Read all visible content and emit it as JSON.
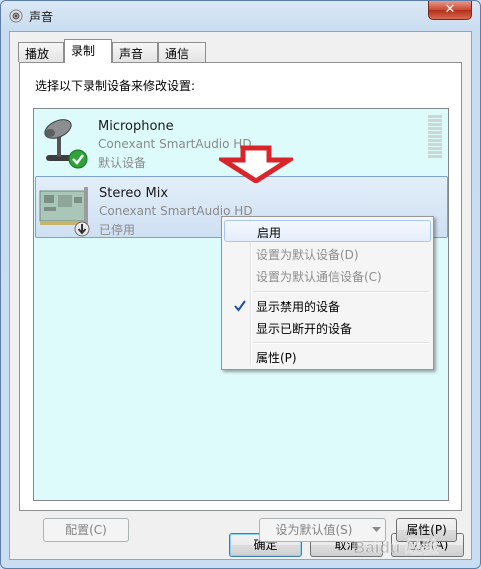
{
  "window": {
    "title": "声音",
    "close_icon": "close-icon"
  },
  "tabs": [
    {
      "label": "播放",
      "active": false
    },
    {
      "label": "录制",
      "active": true
    },
    {
      "label": "声音",
      "active": false
    },
    {
      "label": "通信",
      "active": false
    }
  ],
  "instruction": "选择以下录制设备来修改设置:",
  "devices": [
    {
      "name": "Microphone",
      "driver": "Conexant SmartAudio HD",
      "status": "默认设备",
      "icon": "microphone-icon",
      "badge": "default-check-icon"
    },
    {
      "name": "Stereo Mix",
      "driver": "Conexant SmartAudio HD",
      "status": "已停用",
      "icon": "sound-card-icon",
      "badge": "disabled-arrow-icon",
      "selected": true
    }
  ],
  "context_menu": {
    "items": [
      {
        "label": "启用",
        "enabled": true,
        "hover": true
      },
      {
        "label": "设置为默认设备(D)",
        "enabled": false
      },
      {
        "label": "设置为默认通信设备(C)",
        "enabled": false
      },
      {
        "label": "显示禁用的设备",
        "enabled": true,
        "checked": true
      },
      {
        "label": "显示已断开的设备",
        "enabled": true
      },
      {
        "label": "属性(P)",
        "enabled": true
      }
    ]
  },
  "buttons": {
    "configure": "配置(C)",
    "set_default": "设为默认值(S)",
    "properties": "属性(P)",
    "ok": "确定",
    "cancel": "取消",
    "apply": "应用(A)"
  },
  "colors": {
    "annotation_arrow": "#d9252a",
    "list_background": "#defbfb",
    "selection": "#cfe0f3"
  },
  "watermark_text": "Baidu 经验"
}
